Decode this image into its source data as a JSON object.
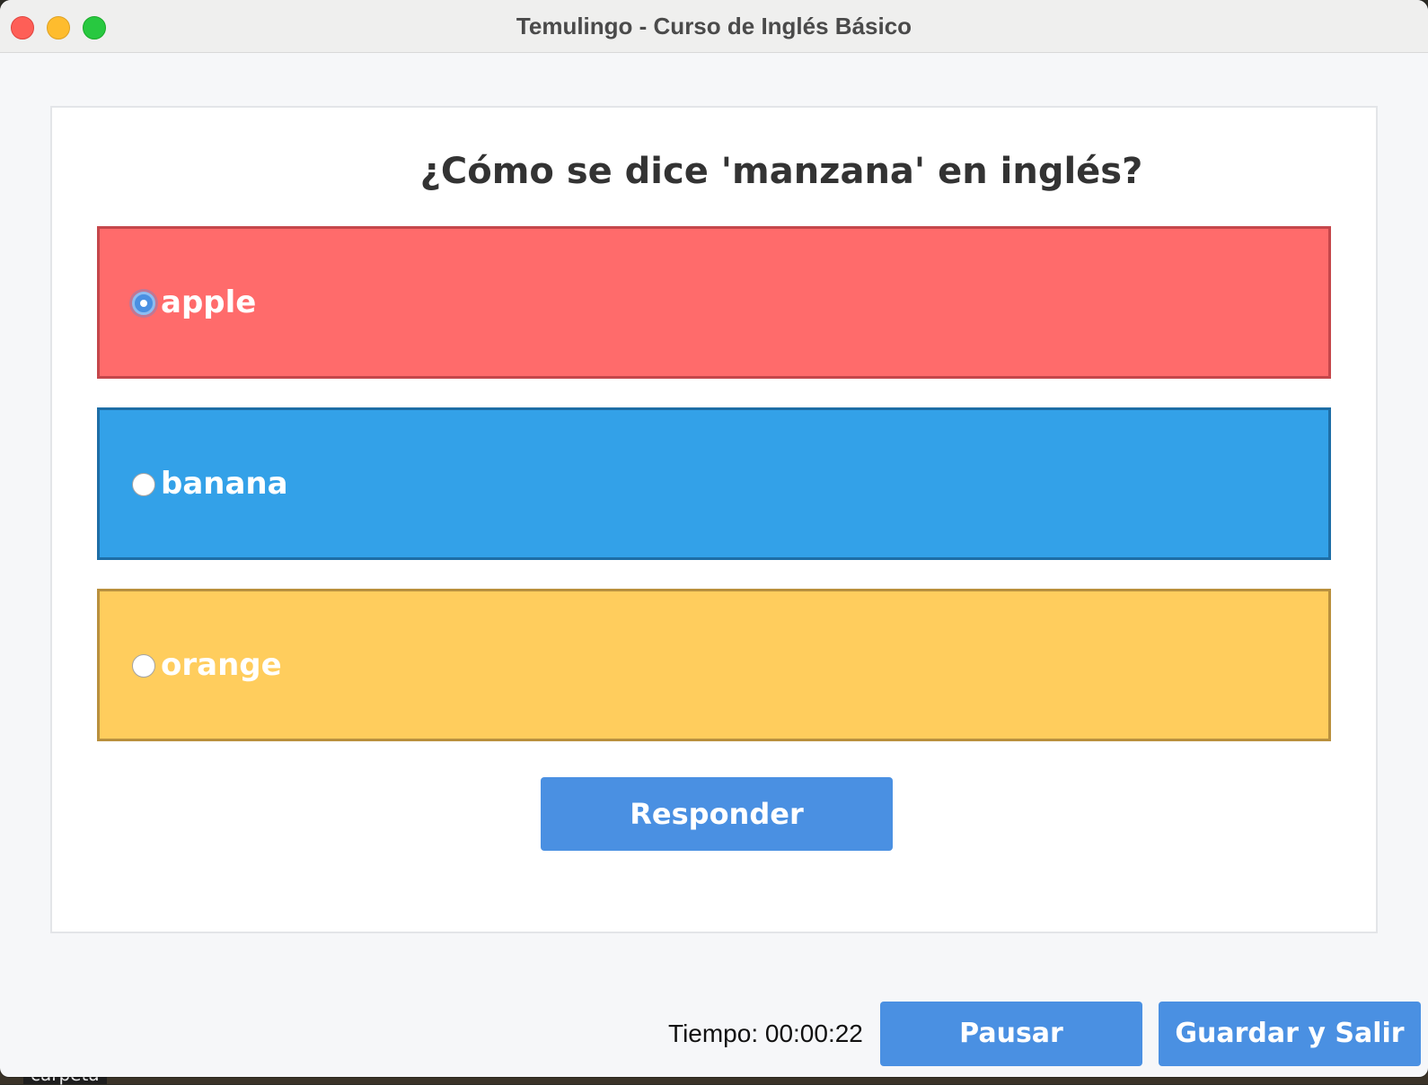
{
  "window": {
    "title": "Temulingo - Curso de Inglés Básico"
  },
  "quiz": {
    "question": "¿Cómo se dice 'manzana' en inglés?",
    "options": [
      {
        "label": "apple",
        "selected": true,
        "color": "#ff6b6b"
      },
      {
        "label": "banana",
        "selected": false,
        "color": "#33a1e8"
      },
      {
        "label": "orange",
        "selected": false,
        "color": "#ffcd5d"
      }
    ],
    "submit_label": "Responder"
  },
  "footer": {
    "timer": "Tiempo: 00:00:22",
    "pause_label": "Pausar",
    "save_exit_label": "Guardar y Salir"
  },
  "desktop": {
    "folder_label": "carpeta"
  },
  "colors": {
    "button": "#4a90e2",
    "background": "#f6f7f9",
    "question_text": "#333333"
  }
}
